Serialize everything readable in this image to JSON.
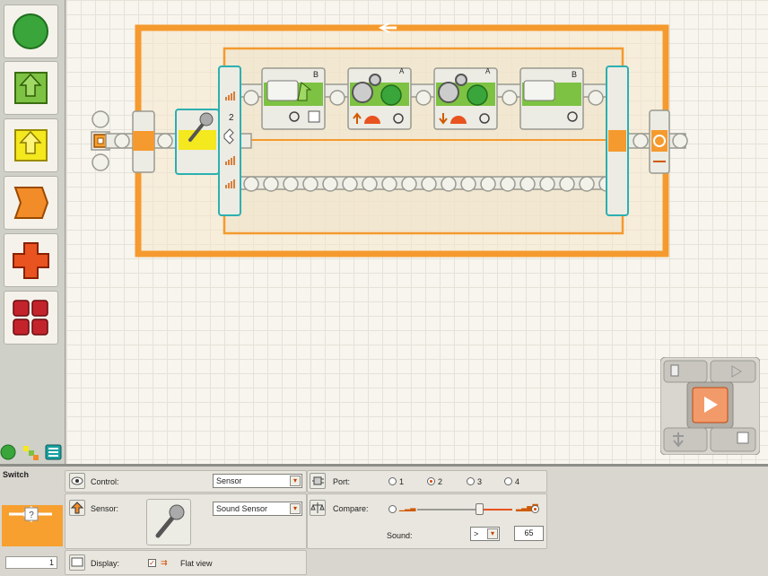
{
  "palette": {
    "items": [
      {
        "name": "common-blocks",
        "color": "#2f9e2f"
      },
      {
        "name": "action-blocks",
        "color": "#7dc242"
      },
      {
        "name": "sensor-blocks",
        "color": "#f4e81e"
      },
      {
        "name": "flow-blocks",
        "color": "#f28c28"
      },
      {
        "name": "data-blocks",
        "color": "#e8531f"
      },
      {
        "name": "advanced-blocks",
        "color": "#c3242c"
      }
    ]
  },
  "program": {
    "switch_port_label": "2",
    "blocks": [
      {
        "type": "motor",
        "port": "B"
      },
      {
        "type": "move",
        "port": "A"
      },
      {
        "type": "move",
        "port": "A"
      },
      {
        "type": "motor",
        "port": "B"
      }
    ]
  },
  "panel": {
    "title": "Switch",
    "count": "1",
    "control_label": "Control:",
    "control_value": "Sensor",
    "sensor_label": "Sensor:",
    "sensor_value": "Sound Sensor",
    "display_label": "Display:",
    "display_value": "Flat view",
    "port_label": "Port:",
    "ports": [
      "1",
      "2",
      "3",
      "4"
    ],
    "port_selected": "2",
    "compare_label": "Compare:",
    "compare_slider": 0.65,
    "sound_label": "Sound:",
    "sound_operator": ">",
    "sound_value": "65"
  },
  "colors": {
    "loop": "#f59a2e",
    "accent": "#d24a00",
    "sensor_yellow": "#f4e81e",
    "motor_green": "#7dc242"
  }
}
